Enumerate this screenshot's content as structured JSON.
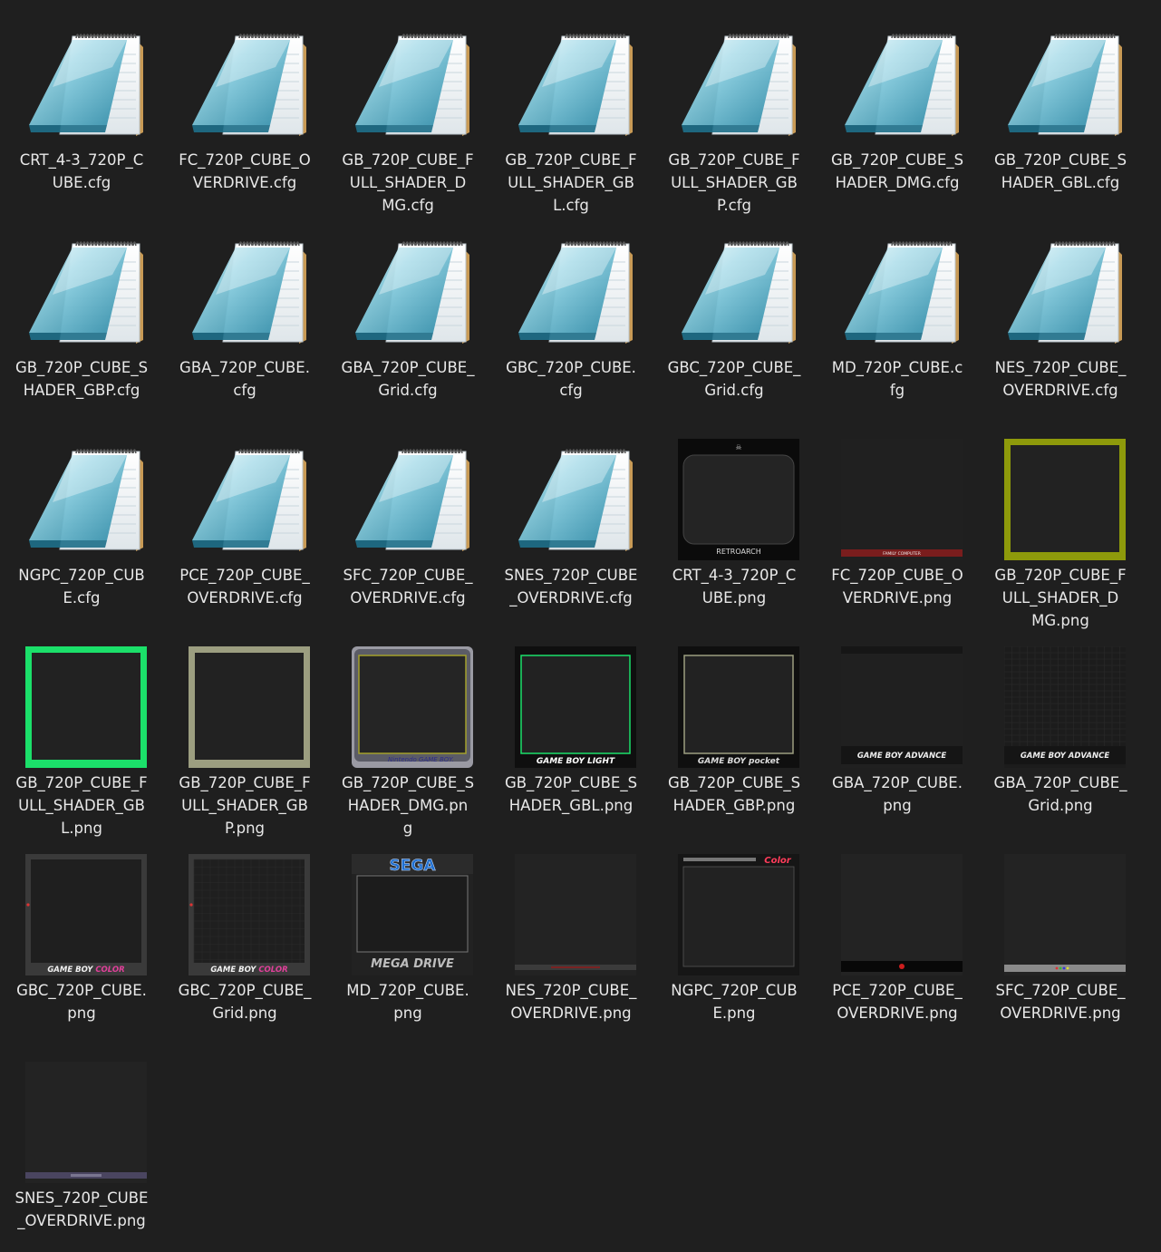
{
  "files": [
    {
      "name": "CRT_4-3_720P_CUBE.cfg",
      "label_lines": [
        "CRT_4-3_720P_C",
        "UBE.cfg"
      ],
      "icon": "notepad-icon"
    },
    {
      "name": "FC_720P_CUBE_OVERDRIVE.cfg",
      "label_lines": [
        "FC_720P_CUBE_O",
        "VERDRIVE.cfg"
      ],
      "icon": "notepad-icon"
    },
    {
      "name": "GB_720P_CUBE_FULL_SHADER_DMG.cfg",
      "label_lines": [
        "GB_720P_CUBE_F",
        "ULL_SHADER_D",
        "MG.cfg"
      ],
      "icon": "notepad-icon"
    },
    {
      "name": "GB_720P_CUBE_FULL_SHADER_GBL.cfg",
      "label_lines": [
        "GB_720P_CUBE_F",
        "ULL_SHADER_GB",
        "L.cfg"
      ],
      "icon": "notepad-icon"
    },
    {
      "name": "GB_720P_CUBE_FULL_SHADER_GBP.cfg",
      "label_lines": [
        "GB_720P_CUBE_F",
        "ULL_SHADER_GB",
        "P.cfg"
      ],
      "icon": "notepad-icon"
    },
    {
      "name": "GB_720P_CUBE_SHADER_DMG.cfg",
      "label_lines": [
        "GB_720P_CUBE_S",
        "HADER_DMG.cfg"
      ],
      "icon": "notepad-icon"
    },
    {
      "name": "GB_720P_CUBE_SHADER_GBL.cfg",
      "label_lines": [
        "GB_720P_CUBE_S",
        "HADER_GBL.cfg"
      ],
      "icon": "notepad-icon"
    },
    {
      "name": "GB_720P_CUBE_SHADER_GBP.cfg",
      "label_lines": [
        "GB_720P_CUBE_S",
        "HADER_GBP.cfg"
      ],
      "icon": "notepad-icon"
    },
    {
      "name": "GBA_720P_CUBE.cfg",
      "label_lines": [
        "GBA_720P_CUBE.",
        "cfg"
      ],
      "icon": "notepad-icon"
    },
    {
      "name": "GBA_720P_CUBE_Grid.cfg",
      "label_lines": [
        "GBA_720P_CUBE_",
        "Grid.cfg"
      ],
      "icon": "notepad-icon"
    },
    {
      "name": "GBC_720P_CUBE.cfg",
      "label_lines": [
        "GBC_720P_CUBE.",
        "cfg"
      ],
      "icon": "notepad-icon"
    },
    {
      "name": "GBC_720P_CUBE_Grid.cfg",
      "label_lines": [
        "GBC_720P_CUBE_",
        "Grid.cfg"
      ],
      "icon": "notepad-icon"
    },
    {
      "name": "MD_720P_CUBE.cfg",
      "label_lines": [
        "MD_720P_CUBE.c",
        "fg"
      ],
      "icon": "notepad-icon"
    },
    {
      "name": "NES_720P_CUBE_OVERDRIVE.cfg",
      "label_lines": [
        "NES_720P_CUBE_",
        "OVERDRIVE.cfg"
      ],
      "icon": "notepad-icon"
    },
    {
      "name": "NGPC_720P_CUBE.cfg",
      "label_lines": [
        "NGPC_720P_CUB",
        "E.cfg"
      ],
      "icon": "notepad-icon"
    },
    {
      "name": "PCE_720P_CUBE_OVERDRIVE.cfg",
      "label_lines": [
        "PCE_720P_CUBE_",
        "OVERDRIVE.cfg"
      ],
      "icon": "notepad-icon"
    },
    {
      "name": "SFC_720P_CUBE_OVERDRIVE.cfg",
      "label_lines": [
        "SFC_720P_CUBE_",
        "OVERDRIVE.cfg"
      ],
      "icon": "notepad-icon"
    },
    {
      "name": "SNES_720P_CUBE_OVERDRIVE.cfg",
      "label_lines": [
        "SNES_720P_CUBE",
        "_OVERDRIVE.cfg"
      ],
      "icon": "notepad-icon"
    },
    {
      "name": "CRT_4-3_720P_CUBE.png",
      "label_lines": [
        "CRT_4-3_720P_C",
        "UBE.png"
      ],
      "icon": "crt-retroarch-preview",
      "preview_text": "RETROARCH"
    },
    {
      "name": "FC_720P_CUBE_OVERDRIVE.png",
      "label_lines": [
        "FC_720P_CUBE_O",
        "VERDRIVE.png"
      ],
      "icon": "famicom-preview",
      "preview_text": "FAMILY COMPUTER"
    },
    {
      "name": "GB_720P_CUBE_FULL_SHADER_DMG.png",
      "label_lines": [
        "GB_720P_CUBE_F",
        "ULL_SHADER_D",
        "MG.png"
      ],
      "icon": "gb-dmg-green-frame-preview"
    },
    {
      "name": "GB_720P_CUBE_FULL_SHADER_GBL.png",
      "label_lines": [
        "GB_720P_CUBE_F",
        "ULL_SHADER_GB",
        "L.png"
      ],
      "icon": "gb-light-green-frame-preview"
    },
    {
      "name": "GB_720P_CUBE_FULL_SHADER_GBP.png",
      "label_lines": [
        "GB_720P_CUBE_F",
        "ULL_SHADER_GB",
        "P.png"
      ],
      "icon": "gb-pocket-frame-preview"
    },
    {
      "name": "GB_720P_CUBE_SHADER_DMG.png",
      "label_lines": [
        "GB_720P_CUBE_S",
        "HADER_DMG.pn",
        "g"
      ],
      "icon": "gameboy-dmg-preview",
      "preview_text": "Nintendo GAME BOY."
    },
    {
      "name": "GB_720P_CUBE_SHADER_GBL.png",
      "label_lines": [
        "GB_720P_CUBE_S",
        "HADER_GBL.png"
      ],
      "icon": "gameboy-light-preview",
      "preview_text": "GAME BOY LIGHT"
    },
    {
      "name": "GB_720P_CUBE_SHADER_GBP.png",
      "label_lines": [
        "GB_720P_CUBE_S",
        "HADER_GBP.png"
      ],
      "icon": "gameboy-pocket-preview",
      "preview_text": "GAME BOY pocket"
    },
    {
      "name": "GBA_720P_CUBE.png",
      "label_lines": [
        "GBA_720P_CUBE.",
        "png"
      ],
      "icon": "gba-preview",
      "preview_text": "GAME BOY ADVANCE"
    },
    {
      "name": "GBA_720P_CUBE_Grid.png",
      "label_lines": [
        "GBA_720P_CUBE_",
        "Grid.png"
      ],
      "icon": "gba-grid-preview",
      "preview_text": "GAME BOY ADVANCE"
    },
    {
      "name": "GBC_720P_CUBE.png",
      "label_lines": [
        "GBC_720P_CUBE.",
        "png"
      ],
      "icon": "gbc-preview",
      "preview_text": "GAME BOY COLOR"
    },
    {
      "name": "GBC_720P_CUBE_Grid.png",
      "label_lines": [
        "GBC_720P_CUBE_",
        "Grid.png"
      ],
      "icon": "gbc-grid-preview",
      "preview_text": "GAME BOY COLOR"
    },
    {
      "name": "MD_720P_CUBE.png",
      "label_lines": [
        "MD_720P_CUBE.",
        "png"
      ],
      "icon": "mega-drive-preview",
      "preview_text": "SEGA",
      "preview_text2": "MEGA DRIVE"
    },
    {
      "name": "NES_720P_CUBE_OVERDRIVE.png",
      "label_lines": [
        "NES_720P_CUBE_",
        "OVERDRIVE.png"
      ],
      "icon": "nes-preview"
    },
    {
      "name": "NGPC_720P_CUBE.png",
      "label_lines": [
        "NGPC_720P_CUB",
        "E.png"
      ],
      "icon": "ngpc-preview",
      "preview_text": "Color"
    },
    {
      "name": "PCE_720P_CUBE_OVERDRIVE.png",
      "label_lines": [
        "PCE_720P_CUBE_",
        "OVERDRIVE.png"
      ],
      "icon": "pce-preview"
    },
    {
      "name": "SFC_720P_CUBE_OVERDRIVE.png",
      "label_lines": [
        "SFC_720P_CUBE_",
        "OVERDRIVE.png"
      ],
      "icon": "sfc-preview"
    },
    {
      "name": "SNES_720P_CUBE_OVERDRIVE.png",
      "label_lines": [
        "SNES_720P_CUBE",
        "_OVERDRIVE.png"
      ],
      "icon": "snes-preview"
    }
  ],
  "colors": {
    "background": "#1f1f1f",
    "label_text": "#e8e8e8",
    "dmg_frame": "#8e9a0b",
    "gbl_frame": "#1be06a",
    "gbp_frame": "#9c9e80"
  }
}
